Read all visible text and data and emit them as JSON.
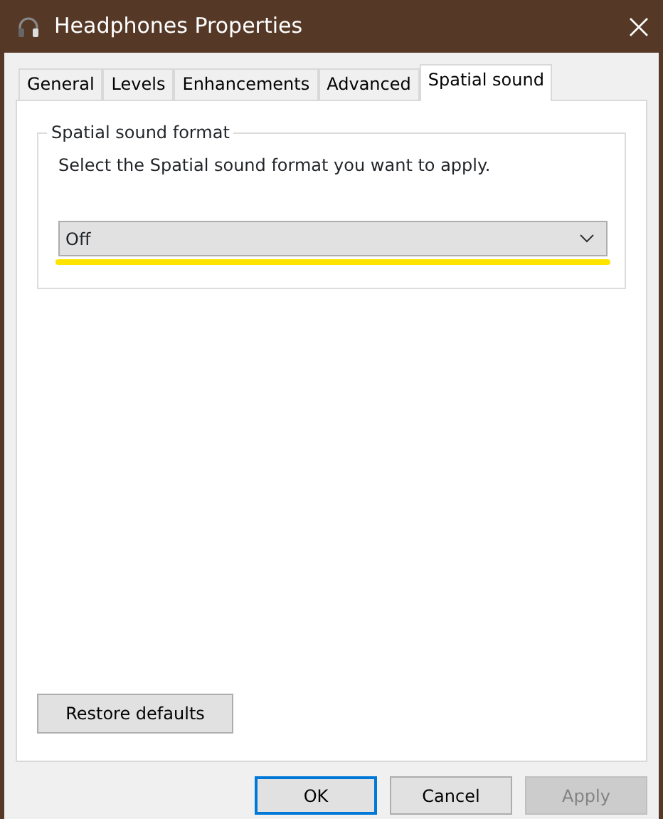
{
  "window": {
    "title": "Headphones Properties"
  },
  "tabs": [
    {
      "label": "General",
      "selected": false
    },
    {
      "label": "Levels",
      "selected": false
    },
    {
      "label": "Enhancements",
      "selected": false
    },
    {
      "label": "Advanced",
      "selected": false
    },
    {
      "label": "Spatial sound",
      "selected": true
    }
  ],
  "group": {
    "title": "Spatial sound format",
    "description": "Select the Spatial sound format you want to apply.",
    "dropdown": {
      "value": "Off",
      "highlighted": true
    }
  },
  "restore_button": "Restore defaults",
  "buttons": [
    {
      "label": "OK",
      "default": true,
      "disabled": false
    },
    {
      "label": "Cancel",
      "default": false,
      "disabled": false
    },
    {
      "label": "Apply",
      "default": false,
      "disabled": true
    }
  ]
}
